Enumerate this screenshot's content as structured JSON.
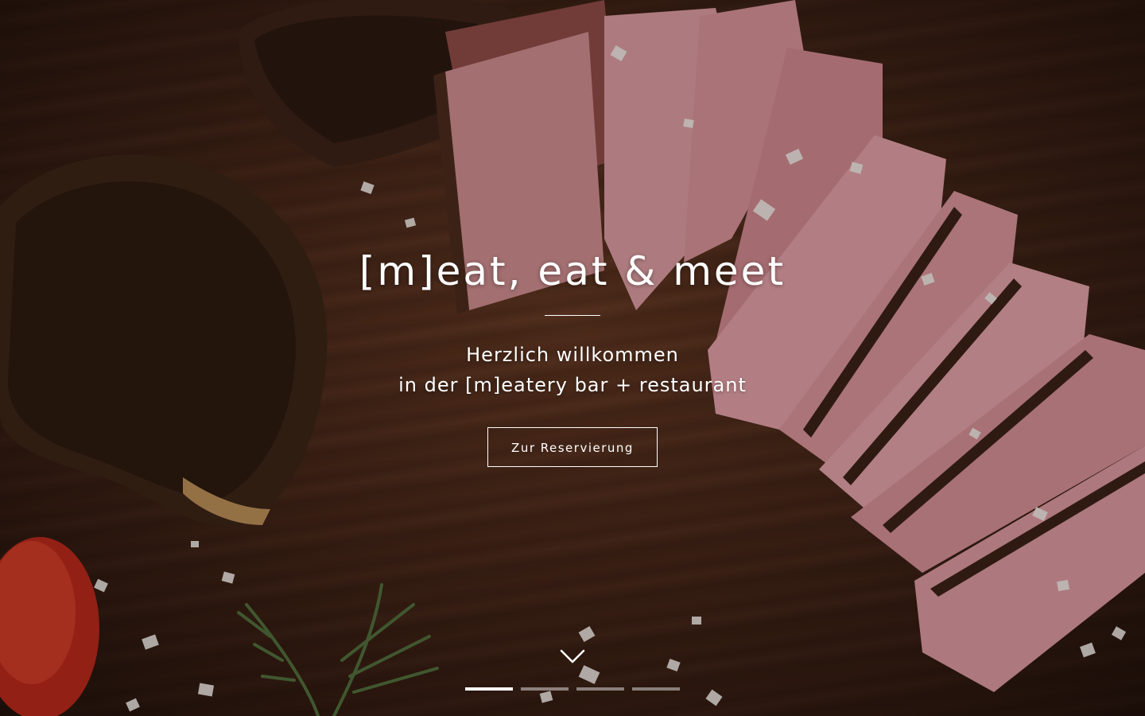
{
  "hero": {
    "title": "[m]eat, eat & meet",
    "subtitle_line1": "Herzlich willkommen",
    "subtitle_line2": "in der [m]eatery bar + restaurant",
    "cta_label": "Zur Reservierung",
    "scroll_icon": "chevron-down-icon"
  },
  "slider": {
    "slide_count": 4,
    "active_index": 0
  },
  "colors": {
    "text": "#ffffff",
    "background": "#4d2b1c"
  }
}
